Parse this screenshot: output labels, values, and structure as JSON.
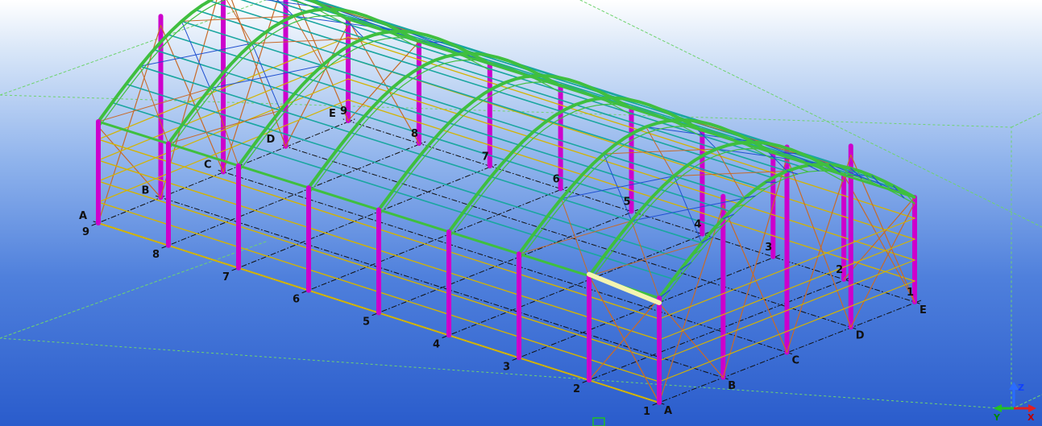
{
  "view": {
    "colors": {
      "column": "#cc00cc",
      "rafter": "#3fbf3f",
      "purlin": "#1aa6a0",
      "girt": "#d4b400",
      "bracing": "#c86a28",
      "roof_bracing": "#2050d0",
      "grid_line": "#111111",
      "selected_member": "#f4f4b0",
      "bounding_box": "#6fd36f"
    }
  },
  "grid_labels": {
    "front_axis": [
      "1",
      "2",
      "3",
      "4",
      "5",
      "6",
      "7",
      "8",
      "9"
    ],
    "back_axis": [
      "1",
      "2",
      "3",
      "4",
      "5",
      "6",
      "7",
      "8",
      "9"
    ],
    "left_axis": [
      "A",
      "B",
      "C",
      "D",
      "E"
    ],
    "right_axis": [
      "A",
      "B",
      "C",
      "D",
      "E"
    ]
  },
  "triad": {
    "x": "X",
    "y": "Y",
    "z": "Z"
  }
}
